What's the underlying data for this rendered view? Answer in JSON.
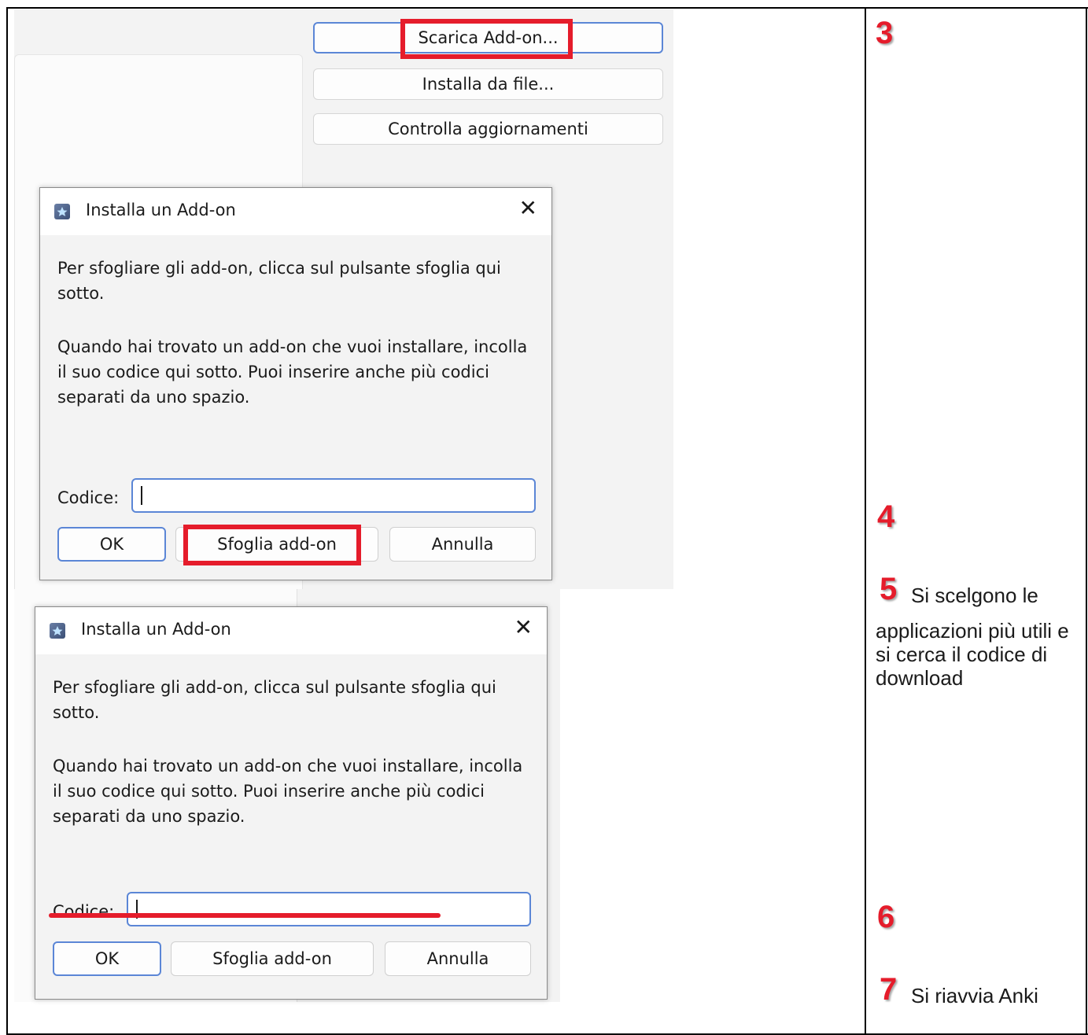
{
  "addon_manager": {
    "buttons": [
      "Scarica Add-on...",
      "Installa da file...",
      "Controlla aggiornamenti"
    ]
  },
  "dialog": {
    "title": "Installa un Add-on",
    "close_icon": "close-icon",
    "paragraph1": "Per sfogliare gli add-on, clicca sul pulsante sfoglia qui sotto.",
    "paragraph2": "Quando hai trovato un add-on che vuoi installare, incolla il suo codice qui sotto. Puoi inserire anche più codici separati da uno spazio.",
    "code_label": "Codice:",
    "code_value": "",
    "ok_label": "OK",
    "browse_label": "Sfoglia add-on",
    "cancel_label": "Annulla"
  },
  "steps": [
    {
      "num": "3",
      "text": ""
    },
    {
      "num": "4",
      "text": ""
    },
    {
      "num": "5",
      "text_line1": "Si scelgono le",
      "text_rest": "applicazioni più utili e si cerca il codice di download"
    },
    {
      "num": "6",
      "text": ""
    },
    {
      "num": "7",
      "text": "Si riavvia Anki"
    }
  ],
  "colors": {
    "highlight": "#e51c2b",
    "focus_border": "#5b86d6"
  }
}
